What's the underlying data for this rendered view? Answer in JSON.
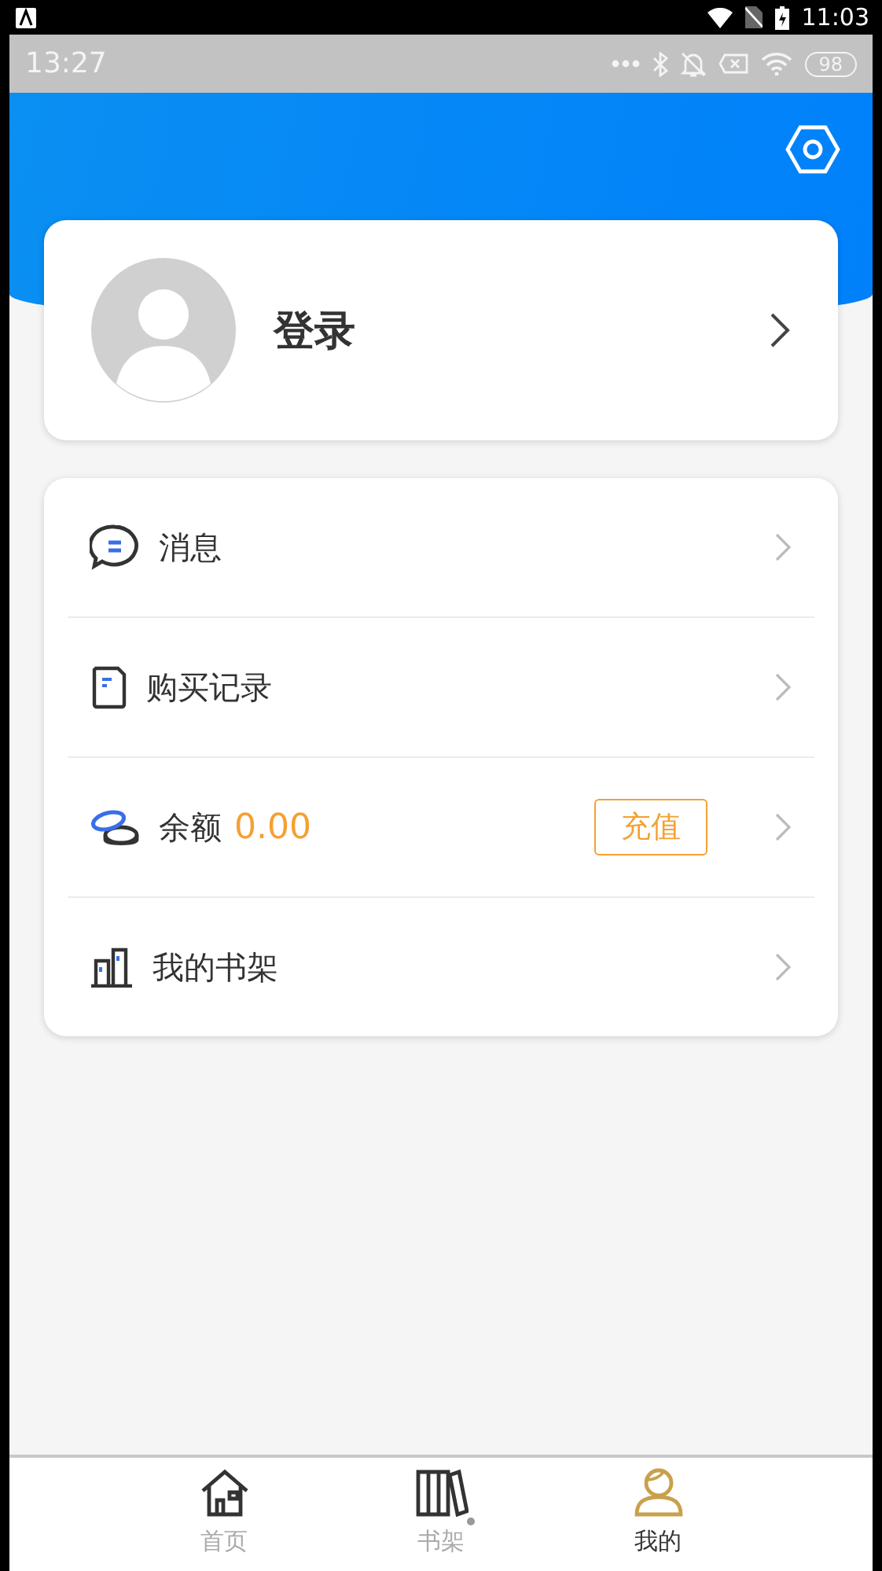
{
  "system_bar": {
    "time": "11:03"
  },
  "app_status_bar": {
    "time": "13:27",
    "battery": "98"
  },
  "profile": {
    "login_label": "登录"
  },
  "menu": [
    {
      "kind": "messages",
      "label": "消息"
    },
    {
      "kind": "purchases",
      "label": "购买记录"
    },
    {
      "kind": "balance",
      "label": "余额",
      "value": "0.00",
      "button": "充值"
    },
    {
      "kind": "shelf",
      "label": "我的书架"
    }
  ],
  "bottom_nav": [
    {
      "kind": "home",
      "label": "首页",
      "selected": false,
      "dot": false
    },
    {
      "kind": "shelf",
      "label": "书架",
      "selected": false,
      "dot": true
    },
    {
      "kind": "me",
      "label": "我的",
      "selected": true,
      "dot": false
    }
  ]
}
